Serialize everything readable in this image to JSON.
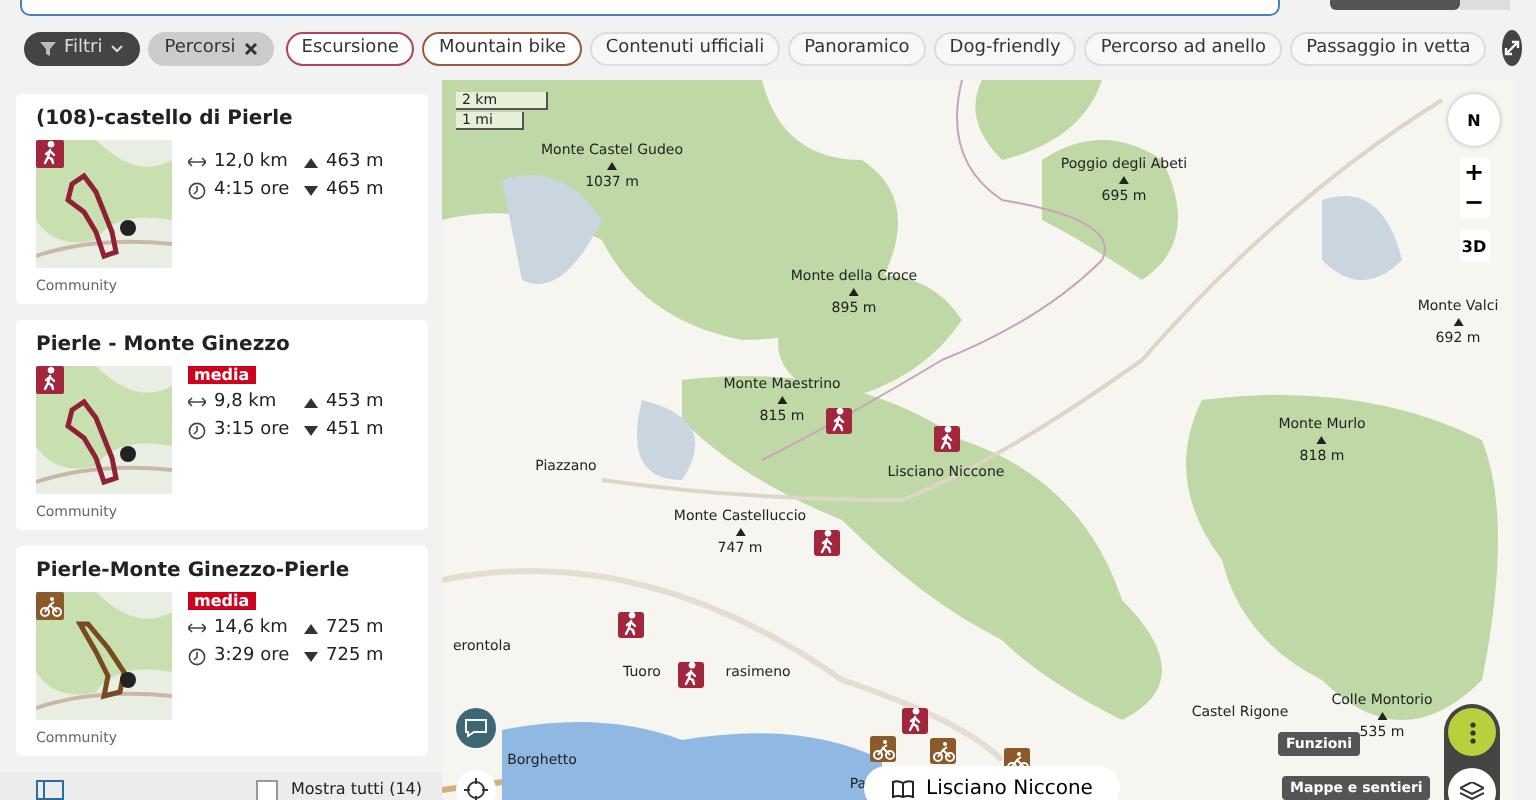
{
  "filter_bar": {
    "filter_button": "Filtri",
    "active_chips": [
      {
        "label": "Percorsi"
      }
    ],
    "chips": [
      {
        "label": "Escursione",
        "selected": true,
        "color": "#b0455b"
      },
      {
        "label": "Mountain bike",
        "selected": true,
        "color": "#9a5a3c"
      },
      {
        "label": "Contenuti ufficiali",
        "selected": false
      },
      {
        "label": "Panoramico",
        "selected": false
      },
      {
        "label": "Dog-friendly",
        "selected": false
      },
      {
        "label": "Percorso ad anello",
        "selected": false
      },
      {
        "label": "Passaggio in vetta",
        "selected": false
      }
    ]
  },
  "routes": [
    {
      "title": "(108)-castello di Pierle",
      "kind": "hiking",
      "distance": "12,0 km",
      "duration": "4:15 ore",
      "ascent": "463 m",
      "descent": "465 m",
      "source": "Community"
    },
    {
      "title": "Pierle - Monte Ginezzo",
      "kind": "hiking",
      "difficulty": "media",
      "distance": "9,8 km",
      "duration": "3:15 ore",
      "ascent": "453 m",
      "descent": "451 m",
      "source": "Community"
    },
    {
      "title": "Pierle-Monte Ginezzo-Pierle",
      "kind": "biking",
      "difficulty": "media",
      "distance": "14,6 km",
      "duration": "3:29 ore",
      "ascent": "725 m",
      "descent": "725 m",
      "source": "Community"
    }
  ],
  "list_footer": {
    "show_all": "Mostra tutti (14)",
    "checked": false
  },
  "map": {
    "scale": [
      "2 km",
      "1 mi"
    ],
    "compass": "N",
    "zoom_in": "+",
    "zoom_out": "−",
    "view_3d": "3D",
    "labels": [
      {
        "kind": "peak",
        "name": "Monte Castel Gudeo",
        "elevation": "1037 m"
      },
      {
        "kind": "peak",
        "name": "Poggio degli Abeti",
        "elevation": "695 m"
      },
      {
        "kind": "peak",
        "name": "Monte della Croce",
        "elevation": "895 m"
      },
      {
        "kind": "peak",
        "name": "Monte Valci",
        "elevation": "692 m"
      },
      {
        "kind": "peak",
        "name": "Monte Maestrino",
        "elevation": "815 m"
      },
      {
        "kind": "peak",
        "name": "Monte Murlo",
        "elevation": "818 m"
      },
      {
        "kind": "place",
        "name": "Piazzano"
      },
      {
        "kind": "place",
        "name": "Lisciano Niccone"
      },
      {
        "kind": "peak",
        "name": "Monte Castelluccio",
        "elevation": "747 m"
      },
      {
        "kind": "place",
        "name": "erontola"
      },
      {
        "kind": "place",
        "name": "Tuoro"
      },
      {
        "kind": "place",
        "name": "rasimeno"
      },
      {
        "kind": "place",
        "name": "Castel Rigone"
      },
      {
        "kind": "peak",
        "name": "Colle Montorio",
        "elevation": "535 m"
      },
      {
        "kind": "place",
        "name": "Borghetto"
      },
      {
        "kind": "place",
        "name": "Pa"
      }
    ],
    "pins": [
      {
        "kind": "hiking"
      },
      {
        "kind": "hiking"
      },
      {
        "kind": "hiking"
      },
      {
        "kind": "hiking"
      },
      {
        "kind": "hiking"
      },
      {
        "kind": "hiking"
      },
      {
        "kind": "biking"
      },
      {
        "kind": "biking"
      },
      {
        "kind": "biking"
      }
    ],
    "functions_button": "Funzioni",
    "maps_button": "Mappe e sentieri",
    "place_card": "Lisciano Niccone"
  }
}
